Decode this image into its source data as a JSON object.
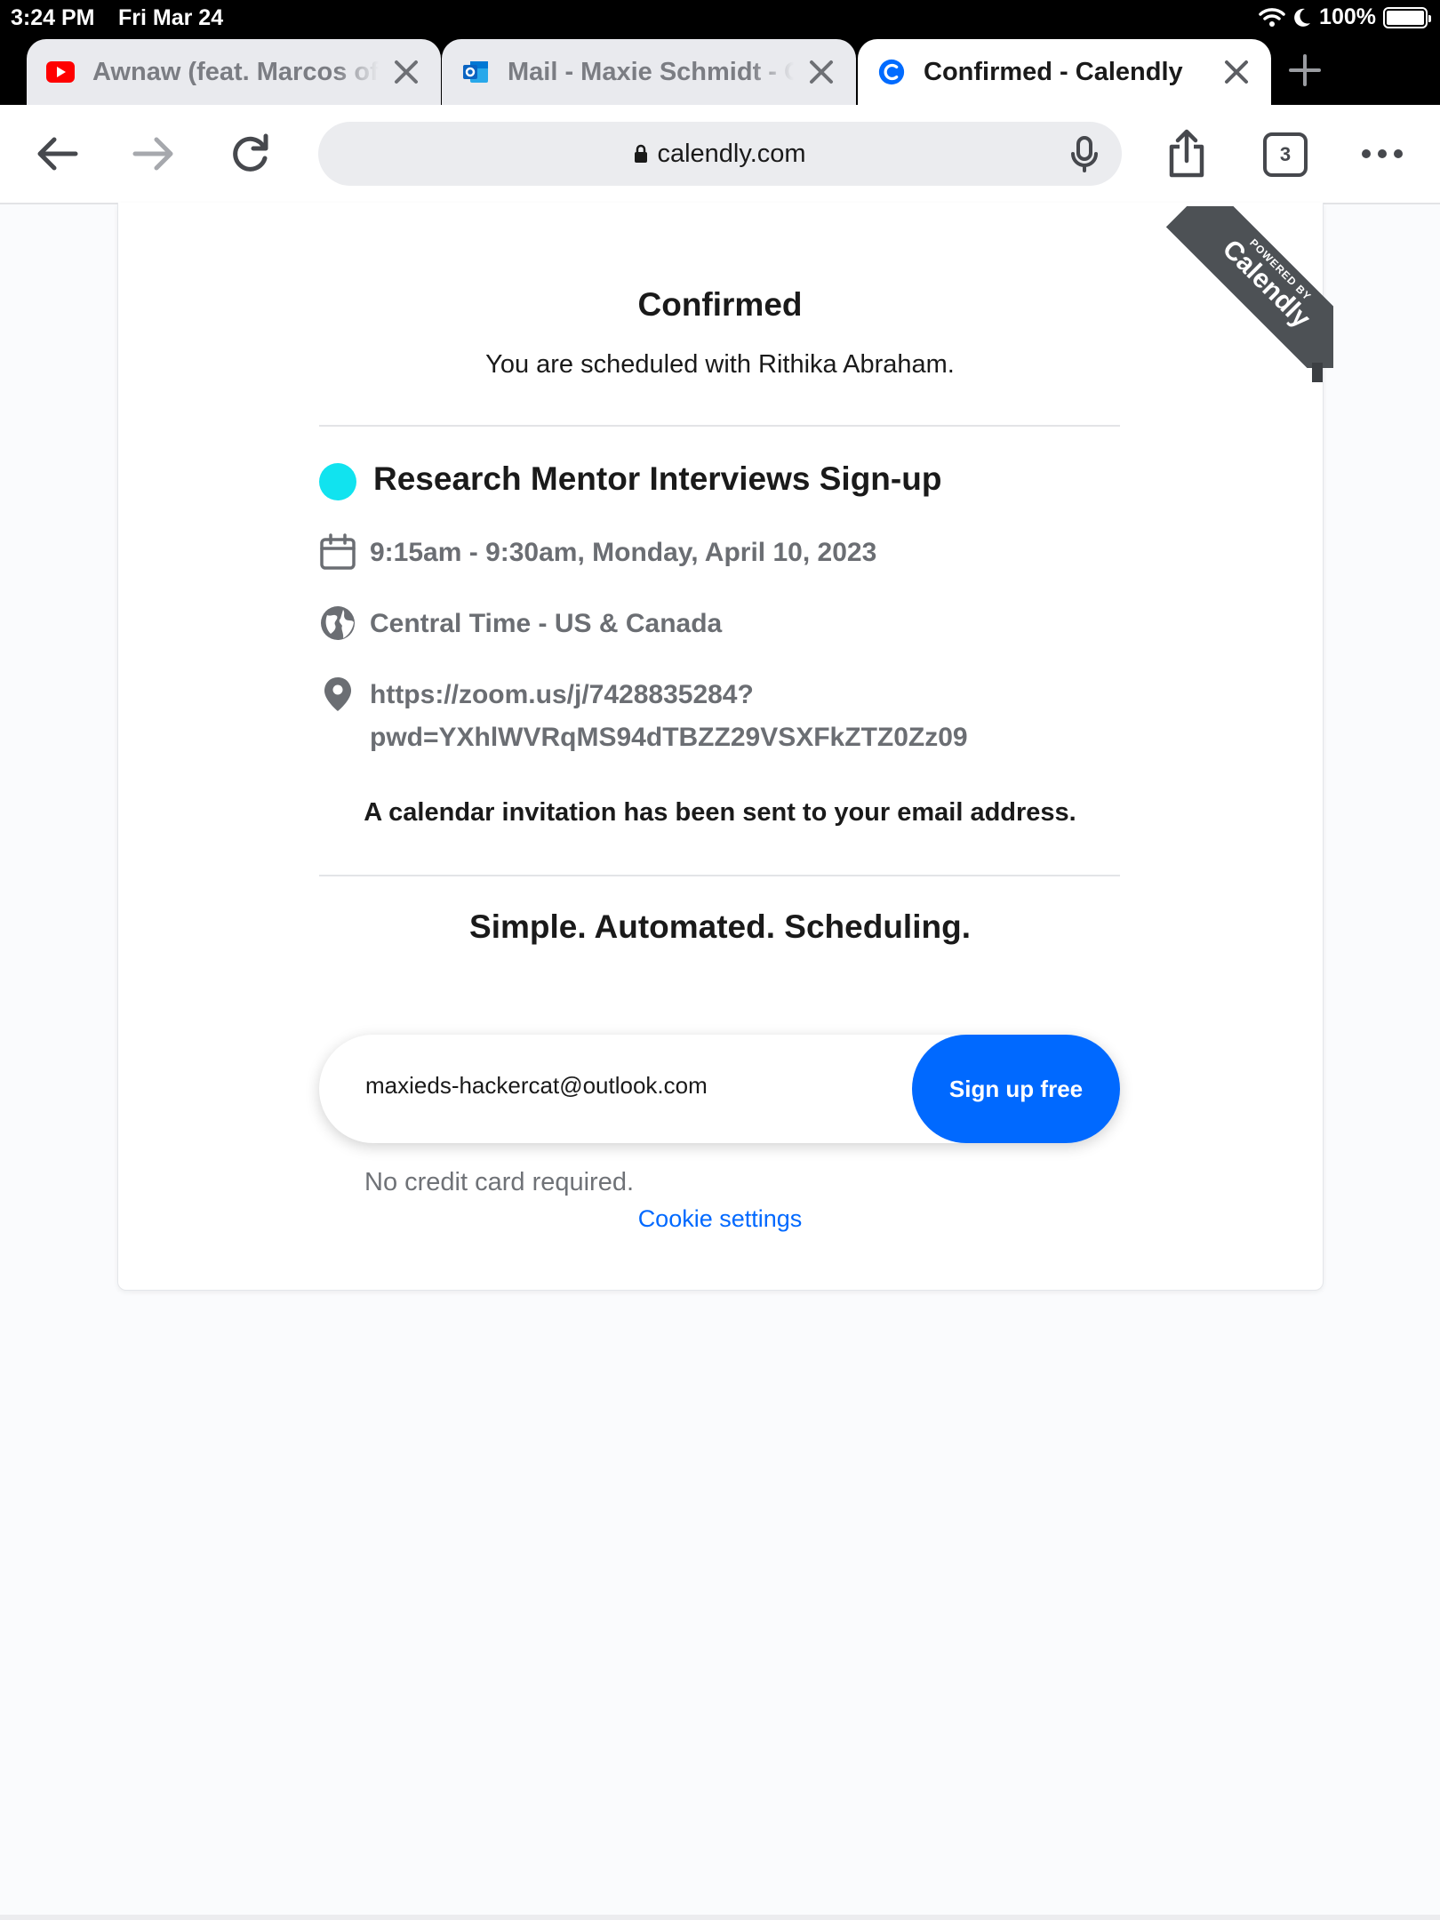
{
  "status_bar": {
    "time": "3:24 PM",
    "date": "Fri Mar 24",
    "battery": "100%"
  },
  "tabs": [
    {
      "title": "Awnaw (feat. Marcos of",
      "favicon": "youtube-icon",
      "active": false
    },
    {
      "title": "Mail - Maxie Schmidt - O",
      "favicon": "outlook-icon",
      "active": false
    },
    {
      "title": "Confirmed - Calendly",
      "favicon": "calendly-icon",
      "active": true
    }
  ],
  "toolbar": {
    "url": "calendly.com",
    "tab_count": "3"
  },
  "page": {
    "heading": "Confirmed",
    "subheading": "You are scheduled with Rithika Abraham.",
    "ribbon_top": "POWERED BY",
    "ribbon_brand": "Calendly",
    "event": {
      "name": "Research Mentor Interviews Sign-up",
      "color": "#11e3ef",
      "time": "9:15am - 9:30am, Monday, April 10, 2023",
      "timezone": "Central Time - US & Canada",
      "location_line1": "https://zoom.us/j/7428835284?",
      "location_line2": "pwd=YXhlWVRqMS94dTBZZ29VSXFkZTZ0Zz09"
    },
    "notice": "A calendar invitation has been sent to your email address.",
    "tagline": "Simple. Automated. Scheduling.",
    "signup": {
      "email": "maxieds-hackercat@outlook.com",
      "button": "Sign up free",
      "accent": "#0069ff"
    },
    "no_credit_card": "No credit card required.",
    "cookie_settings": "Cookie settings"
  }
}
